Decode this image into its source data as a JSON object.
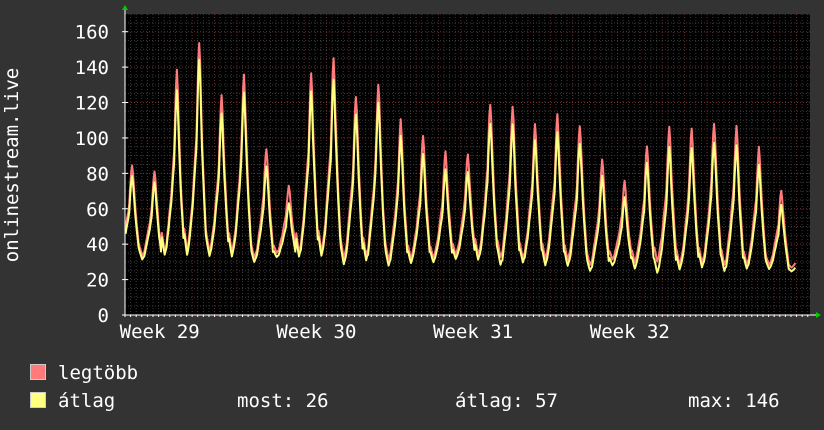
{
  "chart_data": {
    "type": "line",
    "ylabel": "onlinestream.live",
    "ylim": [
      0,
      170
    ],
    "yticks": [
      0,
      20,
      40,
      60,
      80,
      100,
      120,
      140,
      160
    ],
    "x_tick_labels": [
      "Week 29",
      "Week 30",
      "Week 31",
      "Week 32"
    ],
    "daily_peaks": {
      "legtobb": [
        86,
        82,
        139,
        155,
        125,
        138,
        96,
        74,
        138,
        147,
        126,
        132,
        111,
        102,
        93,
        92,
        122,
        120,
        109,
        115,
        109,
        89,
        76,
        96,
        107,
        107,
        111,
        109,
        96,
        71
      ],
      "atlag": [
        80,
        76,
        128,
        146,
        115,
        128,
        86,
        64,
        128,
        135,
        116,
        122,
        102,
        92,
        83,
        82,
        111,
        110,
        100,
        105,
        99,
        80,
        67,
        87,
        96,
        96,
        100,
        98,
        86,
        63
      ]
    },
    "daily_troughs": {
      "legtobb": [
        33,
        31,
        30,
        30,
        31,
        30,
        29,
        33,
        30,
        30,
        27,
        28,
        27,
        28,
        29,
        31,
        29,
        28,
        28,
        27,
        27,
        25,
        29,
        26,
        26,
        24,
        25,
        24,
        25,
        26
      ],
      "atlag": [
        31,
        29,
        29,
        28,
        29,
        28,
        27,
        31,
        28,
        28,
        24,
        26,
        24,
        26,
        27,
        29,
        27,
        24,
        26,
        24,
        24,
        22,
        26,
        23,
        20,
        22,
        23,
        21,
        23,
        24
      ]
    },
    "series": [
      {
        "name": "legtöbb",
        "color": "#ff7b7b"
      },
      {
        "name": "átlag",
        "color": "#ffff80"
      }
    ],
    "grid": true,
    "background": "#000000"
  },
  "legend": {
    "max_label": "legtöbb",
    "avg_label": "átlag"
  },
  "stats": {
    "current": "most: 26",
    "average": "átlag: 57",
    "maximum": "max: 146"
  }
}
